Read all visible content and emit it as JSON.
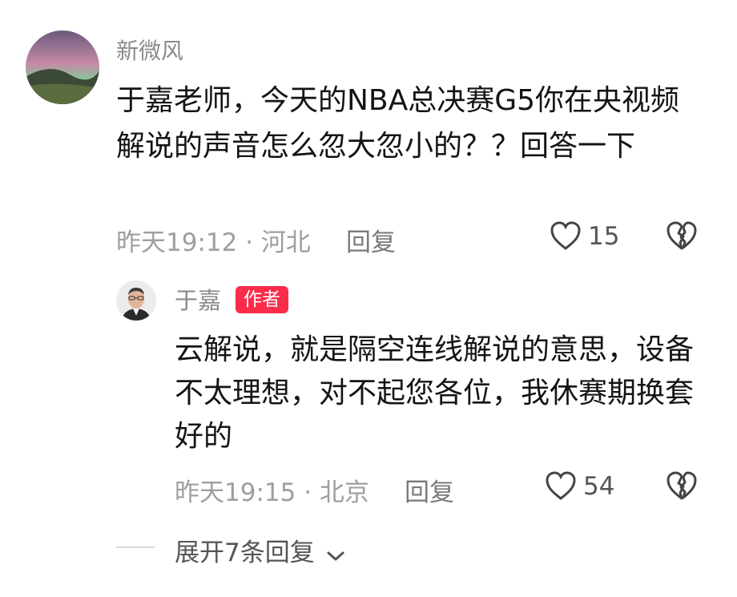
{
  "comment": {
    "username": "新微风",
    "text": "于嘉老师，今天的NBA总决赛G5你在央视频解说的声音怎么忽大忽小的？？回答一下",
    "meta": "昨天19:12 · 河北",
    "reply_label": "回复",
    "likes": "15",
    "avatar_icon": "aurora-landscape-avatar"
  },
  "reply": {
    "username": "于嘉",
    "badge": "作者",
    "text": "云解说，就是隔空连线解说的意思，设备不太理想，对不起您各位，我休赛期换套好的",
    "meta": "昨天19:15 · 北京",
    "reply_label": "回复",
    "likes": "54",
    "avatar_icon": "man-portrait-avatar"
  },
  "expand": {
    "label": "展开7条回复"
  },
  "colors": {
    "badge_bg": "#fa2c4a",
    "primary_text": "#141414",
    "muted_text": "#9e9e9e"
  }
}
